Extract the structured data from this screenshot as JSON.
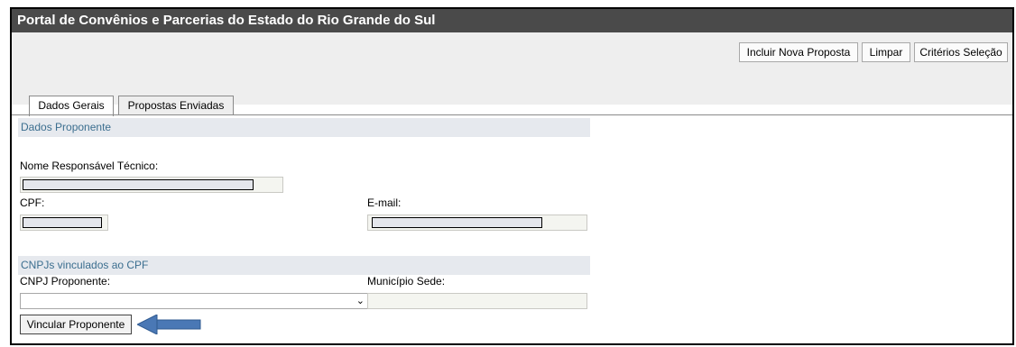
{
  "window": {
    "title": "Portal de Convênios e Parcerias do Estado do Rio Grande do Sul"
  },
  "toolbar": {
    "buttons": [
      "Incluir Nova Proposta",
      "Limpar",
      "Critérios Seleção"
    ]
  },
  "tabs": [
    {
      "label": "Dados Gerais",
      "active": true
    },
    {
      "label": "Propostas Enviadas",
      "active": false
    }
  ],
  "sections": {
    "proponente": "Dados Proponente",
    "cnpjs": "CNPJs vinculados ao CPF"
  },
  "fields": {
    "responsavel_label": "Nome Responsável Técnico:",
    "cpf_label": "CPF:",
    "email_label": "E-mail:",
    "cnpj_label": "CNPJ Proponente:",
    "municipio_label": "Município Sede:"
  },
  "actions": {
    "vincular": "Vincular Proponente"
  },
  "colors": {
    "title_bg": "#4a4a4a",
    "section_text": "#3b6e8f",
    "arrow": "#4a78b5"
  }
}
